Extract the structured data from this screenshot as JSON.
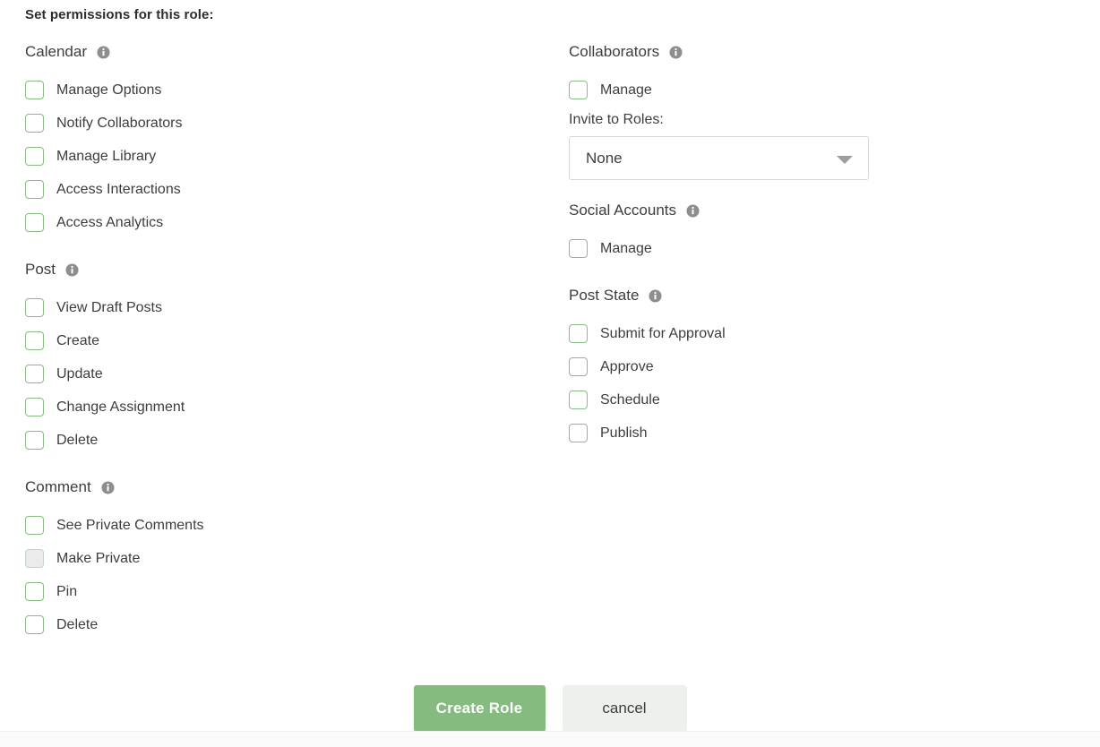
{
  "heading": "Set permissions for this role:",
  "colors": {
    "checkbox_border": "#8cbb87",
    "primary_button": "#85ba80",
    "secondary_button": "#eef0ee",
    "info_icon": "#8e8e8e",
    "text": "#3d3d3d"
  },
  "info_icon_name": "info-icon",
  "left_column": [
    {
      "title": "Calendar",
      "has_info": true,
      "items": [
        {
          "label": "Manage Options",
          "checked": false,
          "disabled": false
        },
        {
          "label": "Notify Collaborators",
          "checked": false,
          "disabled": false
        },
        {
          "label": "Manage Library",
          "checked": false,
          "disabled": false
        },
        {
          "label": "Access Interactions",
          "checked": false,
          "disabled": false
        },
        {
          "label": "Access Analytics",
          "checked": false,
          "disabled": false
        }
      ]
    },
    {
      "title": "Post",
      "has_info": true,
      "items": [
        {
          "label": "View Draft Posts",
          "checked": false,
          "disabled": false
        },
        {
          "label": "Create",
          "checked": false,
          "disabled": false
        },
        {
          "label": "Update",
          "checked": false,
          "disabled": false
        },
        {
          "label": "Change Assignment",
          "checked": false,
          "disabled": false
        },
        {
          "label": "Delete",
          "checked": false,
          "disabled": false
        }
      ]
    },
    {
      "title": "Comment",
      "has_info": true,
      "items": [
        {
          "label": "See Private Comments",
          "checked": false,
          "disabled": false
        },
        {
          "label": "Make Private",
          "checked": false,
          "disabled": true
        },
        {
          "label": "Pin",
          "checked": false,
          "disabled": false
        },
        {
          "label": "Delete",
          "checked": false,
          "disabled": false
        }
      ]
    }
  ],
  "right_column": [
    {
      "title": "Collaborators",
      "has_info": true,
      "items": [
        {
          "label": "Manage",
          "checked": false,
          "disabled": false
        }
      ],
      "select": {
        "label": "Invite to Roles:",
        "value": "None",
        "options": [
          "None"
        ]
      }
    },
    {
      "title": "Social Accounts",
      "has_info": true,
      "items": [
        {
          "label": "Manage",
          "checked": false,
          "disabled": false
        }
      ]
    },
    {
      "title": "Post State",
      "has_info": true,
      "items": [
        {
          "label": "Submit for Approval",
          "checked": false,
          "disabled": false
        },
        {
          "label": "Approve",
          "checked": false,
          "disabled": false
        },
        {
          "label": "Schedule",
          "checked": false,
          "disabled": false
        },
        {
          "label": "Publish",
          "checked": false,
          "disabled": false
        }
      ]
    }
  ],
  "footer": {
    "primary_label": "Create Role",
    "secondary_label": "cancel"
  }
}
